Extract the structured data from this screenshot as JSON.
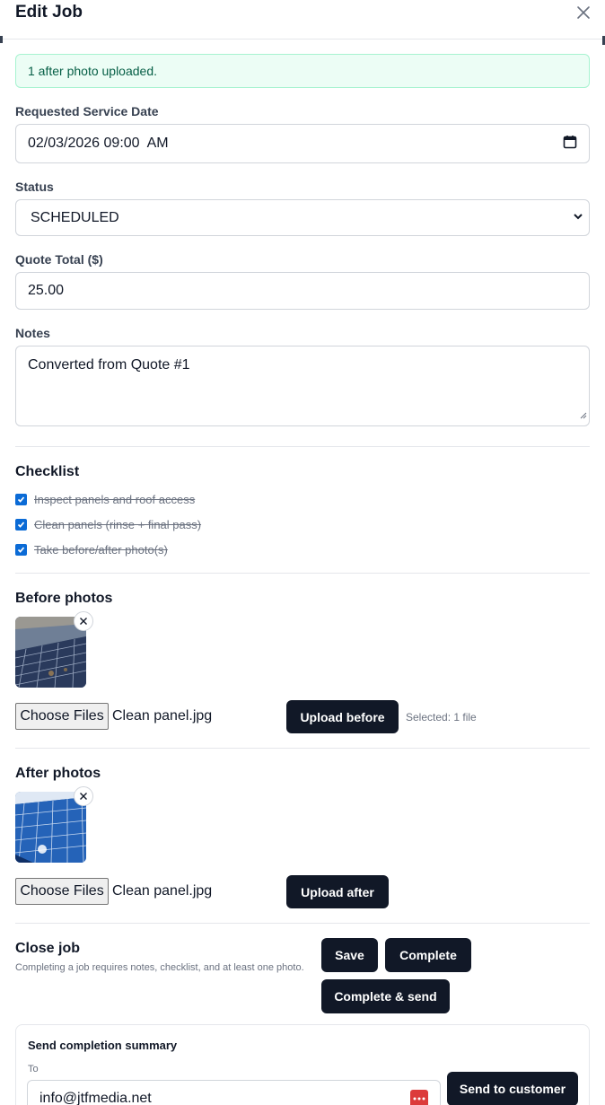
{
  "dialog": {
    "title": "Edit Job"
  },
  "alert": {
    "text": "1 after photo uploaded."
  },
  "form": {
    "service_date": {
      "label": "Requested Service Date",
      "value": "02/03/2026 09:00  AM"
    },
    "status": {
      "label": "Status",
      "value": "SCHEDULED"
    },
    "quote_total": {
      "label": "Quote Total ($)",
      "value": "25.00"
    },
    "notes": {
      "label": "Notes",
      "value": "Converted from Quote #1"
    }
  },
  "checklist": {
    "title": "Checklist",
    "items": [
      {
        "label": "Inspect panels and roof access",
        "checked": true
      },
      {
        "label": "Clean panels (rinse + final pass)",
        "checked": true
      },
      {
        "label": "Take before/after photo(s)",
        "checked": true
      }
    ]
  },
  "before_photos": {
    "title": "Before photos",
    "choose_label": "Choose Files",
    "file_name": "Clean panel.jpg",
    "upload_label": "Upload before",
    "selected_text": "Selected: 1 file"
  },
  "after_photos": {
    "title": "After photos",
    "choose_label": "Choose Files",
    "file_name": "Clean panel.jpg",
    "upload_label": "Upload after"
  },
  "close_job": {
    "title": "Close job",
    "help": "Completing a job requires notes, checklist, and at least one photo.",
    "save_label": "Save",
    "complete_label": "Complete",
    "complete_send_label": "Complete & send"
  },
  "completion_summary": {
    "title": "Send completion summary",
    "to_label": "To",
    "to_value": "info@jtfmedia.net",
    "send_label": "Send to customer"
  },
  "colors": {
    "primary_dark": "#111827",
    "success_bg": "#ecfdf5",
    "success_border": "#a7f3d0",
    "checkbox_blue": "#0b6bd6"
  }
}
